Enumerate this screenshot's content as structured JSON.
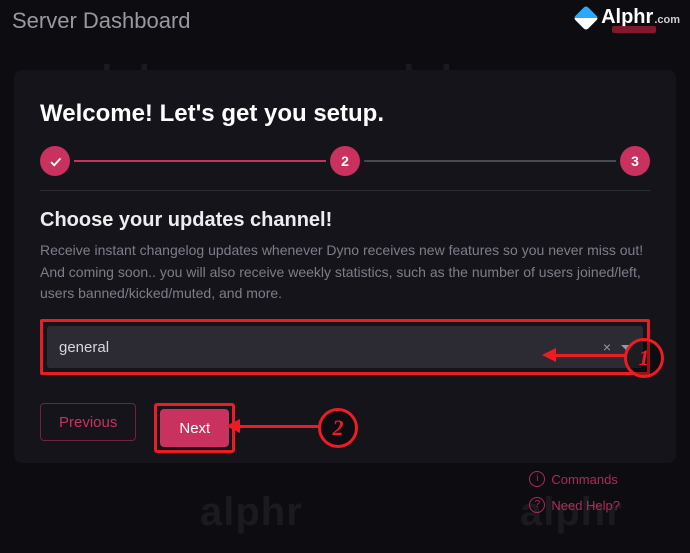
{
  "page": {
    "title": "Server Dashboard"
  },
  "brand": {
    "name": "Alphr",
    "tld": ".com"
  },
  "modal": {
    "heading": "Welcome! Let's get you setup.",
    "steps": {
      "s2": "2",
      "s3": "3"
    },
    "section_title": "Choose your updates channel!",
    "section_desc_line1": "Receive instant changelog updates whenever Dyno receives new features so you never miss out!",
    "section_desc_line2": "And coming soon.. you will also receive weekly statistics, such as the number of users joined/left, users banned/kicked/muted, and more.",
    "select_value": "general",
    "clear_symbol": "×",
    "prev_label": "Previous",
    "next_label": "Next"
  },
  "annotations": {
    "m1": "1",
    "m2": "2"
  },
  "footer": {
    "commands": "Commands",
    "need_help": "Need Help?"
  },
  "watermark": "alphr"
}
